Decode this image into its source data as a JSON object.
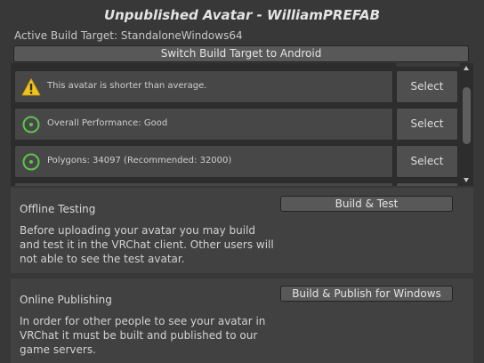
{
  "header": {
    "title": "Unpublished Avatar - WilliamPREFAB",
    "build_target": "Active Build Target: StandaloneWindows64",
    "switch_label": "Switch Build Target to Android"
  },
  "validations": [
    {
      "icon": "warning-icon",
      "message": "This avatar is shorter than average.",
      "action": "Select"
    },
    {
      "icon": "performance-good-icon",
      "message": "Overall Performance: Good",
      "action": "Select"
    },
    {
      "icon": "performance-good-icon",
      "message": "Polygons: 34097 (Recommended: 32000)",
      "action": "Select"
    }
  ],
  "offline": {
    "title": "Offline Testing",
    "description": "Before uploading your avatar you may build and test it in the VRChat client. Other users will not able to see the test avatar.",
    "button": "Build & Test"
  },
  "online": {
    "title": "Online Publishing",
    "description": "In order for other people to see your avatar in VRChat it must be built and published to our game servers.",
    "button": "Build & Publish for Windows"
  },
  "colors": {
    "warning": "#f0c419",
    "good": "#5cc64b"
  }
}
